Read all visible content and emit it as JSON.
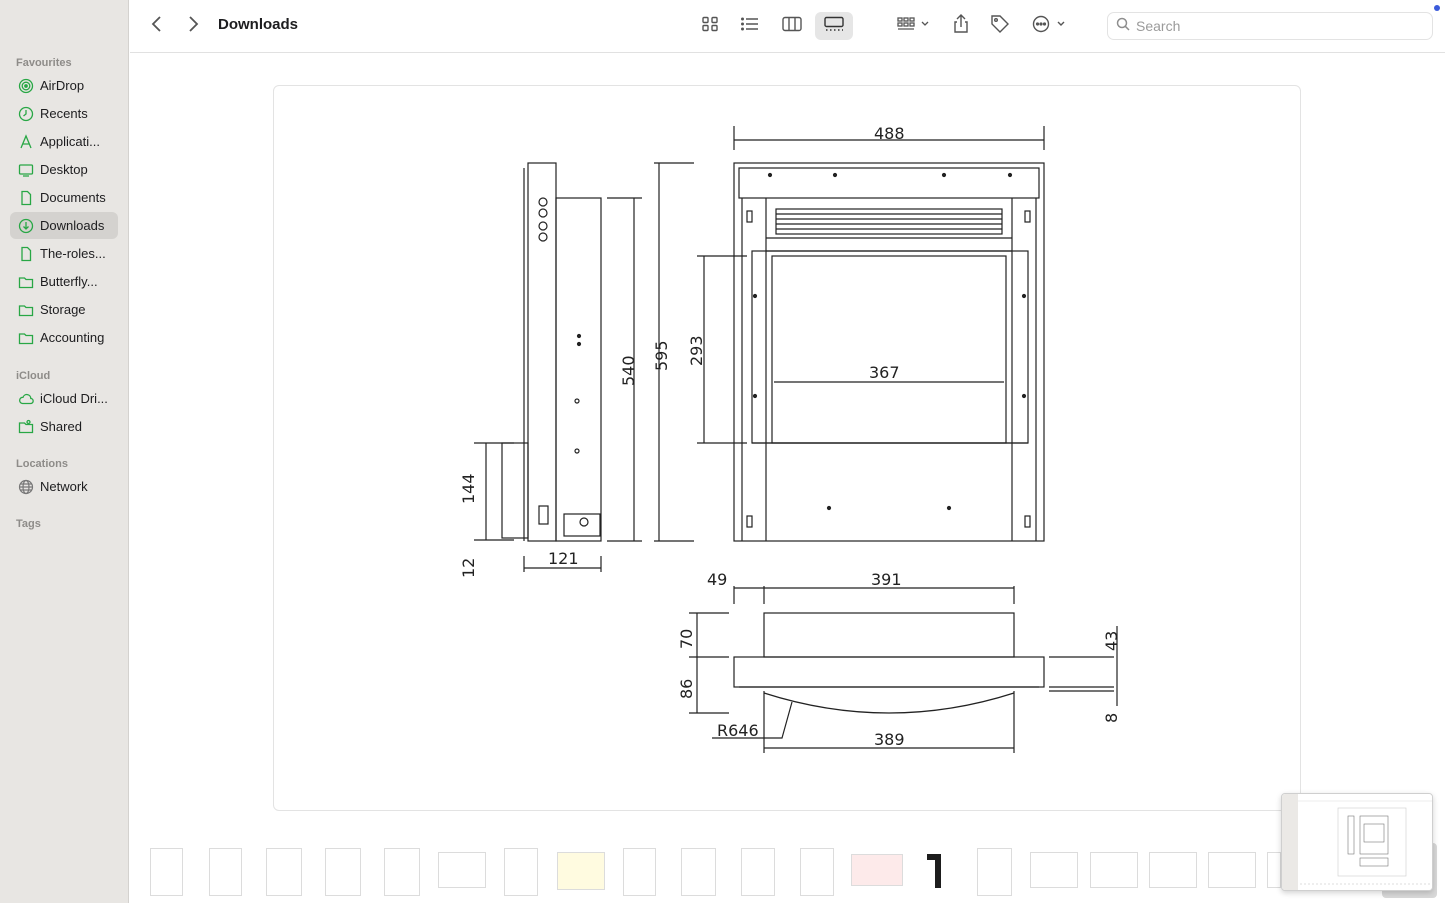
{
  "window": {
    "title": "Downloads"
  },
  "sidebar": {
    "sections": [
      {
        "label": "Favourites"
      },
      {
        "label": "iCloud"
      },
      {
        "label": "Locations"
      },
      {
        "label": "Tags"
      }
    ],
    "favourites": [
      {
        "label": "AirDrop",
        "icon": "airdrop-icon"
      },
      {
        "label": "Recents",
        "icon": "clock-icon"
      },
      {
        "label": "Applicati...",
        "icon": "applications-icon"
      },
      {
        "label": "Desktop",
        "icon": "desktop-icon"
      },
      {
        "label": "Documents",
        "icon": "document-icon"
      },
      {
        "label": "Downloads",
        "icon": "download-icon",
        "active": true
      },
      {
        "label": "The-roles...",
        "icon": "document-icon"
      },
      {
        "label": "Butterfly...",
        "icon": "folder-icon"
      },
      {
        "label": "Storage",
        "icon": "folder-icon"
      },
      {
        "label": "Accounting",
        "icon": "folder-icon"
      }
    ],
    "icloud": [
      {
        "label": "iCloud Dri...",
        "icon": "cloud-icon"
      },
      {
        "label": "Shared",
        "icon": "shared-folder-icon"
      }
    ],
    "locations": [
      {
        "label": "Network",
        "icon": "globe-icon"
      }
    ]
  },
  "toolbar": {
    "search_placeholder": "Search",
    "view_modes": [
      "icon-view",
      "list-view",
      "column-view",
      "gallery-view"
    ],
    "active_view": "gallery-view"
  },
  "drawing": {
    "dimensions": {
      "top_width": "488",
      "side_height": "540",
      "front_height": "595",
      "opening_height": "293",
      "opening_width": "367",
      "side_bottom": "144",
      "side_offset": "12",
      "side_depth": "121",
      "plan_left": "49",
      "plan_width": "391",
      "plan_depth": "70",
      "plan_frame": "86",
      "plan_right": "43",
      "plan_small": "8",
      "plan_radius": "R646",
      "plan_bottom": "389"
    }
  },
  "colors": {
    "accent": "#28a745",
    "selection": "#d4d2cf",
    "notification_dot": "#3b5bdb"
  }
}
